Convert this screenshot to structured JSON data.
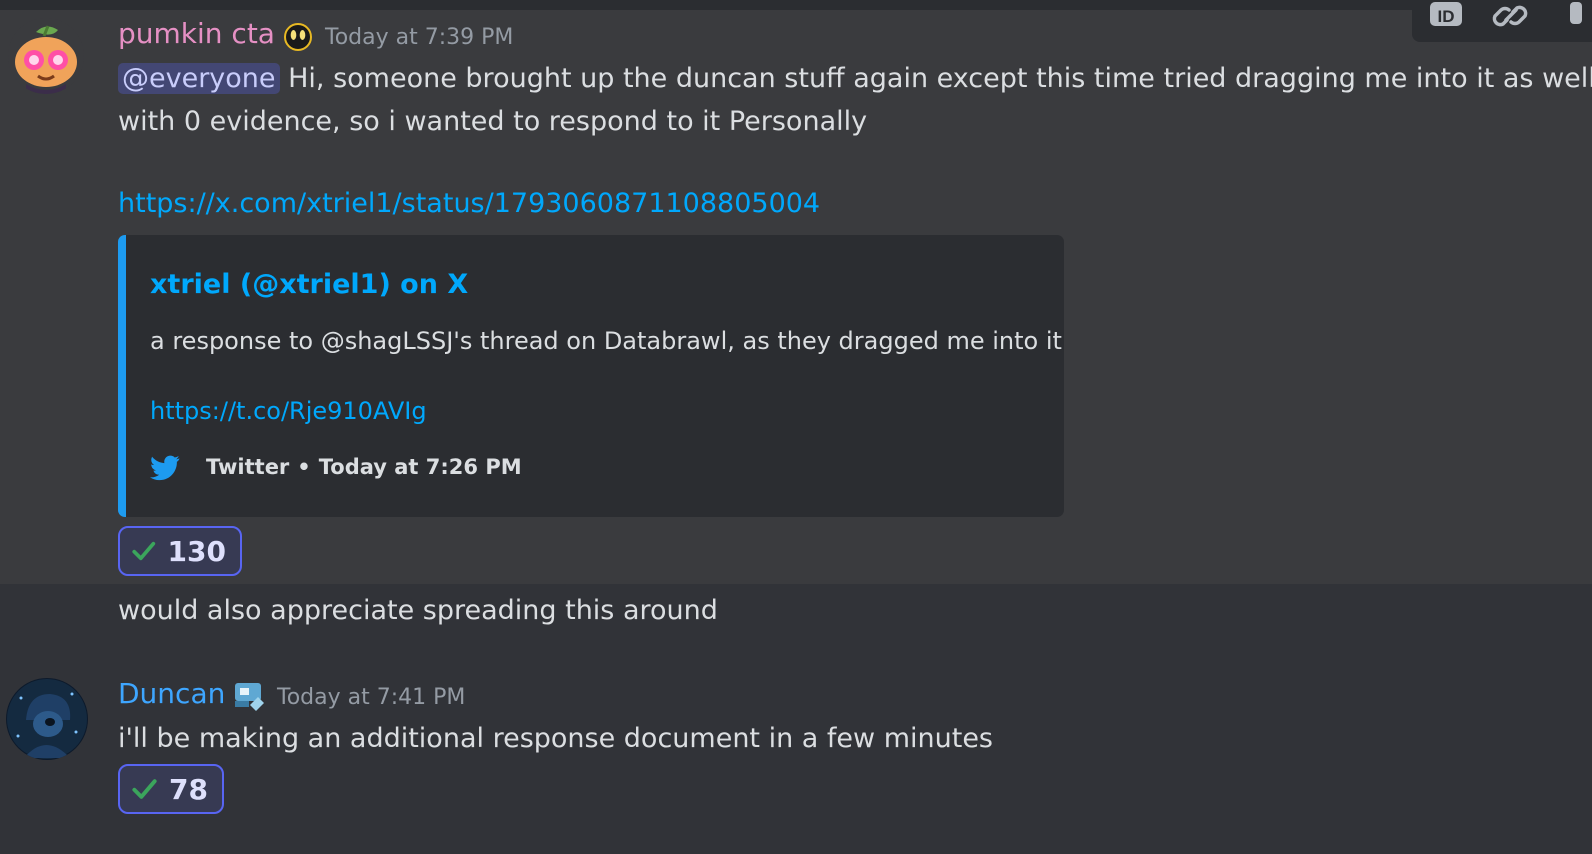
{
  "messages": [
    {
      "username": "pumkin cta",
      "username_color": "#e590c4",
      "timestamp": "Today at 7:39 PM",
      "mention": "@everyone",
      "text_line1": "Hi, someone brought up the duncan stuff again except this time tried dragging me into it as well",
      "text_line2": "with 0 evidence, so i wanted to respond to it Personally",
      "link": "https://x.com/xtriel1/status/1793060871108805004",
      "embed": {
        "title": "xtriel (@xtriel1) on X",
        "description": "a response to @shagLSSJ's thread on Databrawl, as they dragged me into it",
        "link": "https://t.co/Rje910AVIg",
        "footer_source": "Twitter",
        "footer_separator": "•",
        "footer_time": "Today at 7:26 PM"
      },
      "reaction": {
        "emoji": "check-mark-icon",
        "count": "130"
      },
      "followup": "would also appreciate spreading this around"
    },
    {
      "username": "Duncan",
      "username_color": "#3ea6ff",
      "timestamp": "Today at 7:41 PM",
      "text": "i'll be making an additional response document in a few minutes",
      "reaction": {
        "emoji": "check-mark-icon",
        "count": "78"
      }
    }
  ],
  "toolbar": {
    "icons": [
      "id-icon",
      "link-icon",
      "more-icon"
    ]
  },
  "colors": {
    "background": "#313338",
    "hover": "#3a3b3e",
    "embed_bg": "#2b2d31",
    "embed_border": "#1d9bf0",
    "link": "#00a8fc",
    "reaction_border": "#5865f2"
  }
}
